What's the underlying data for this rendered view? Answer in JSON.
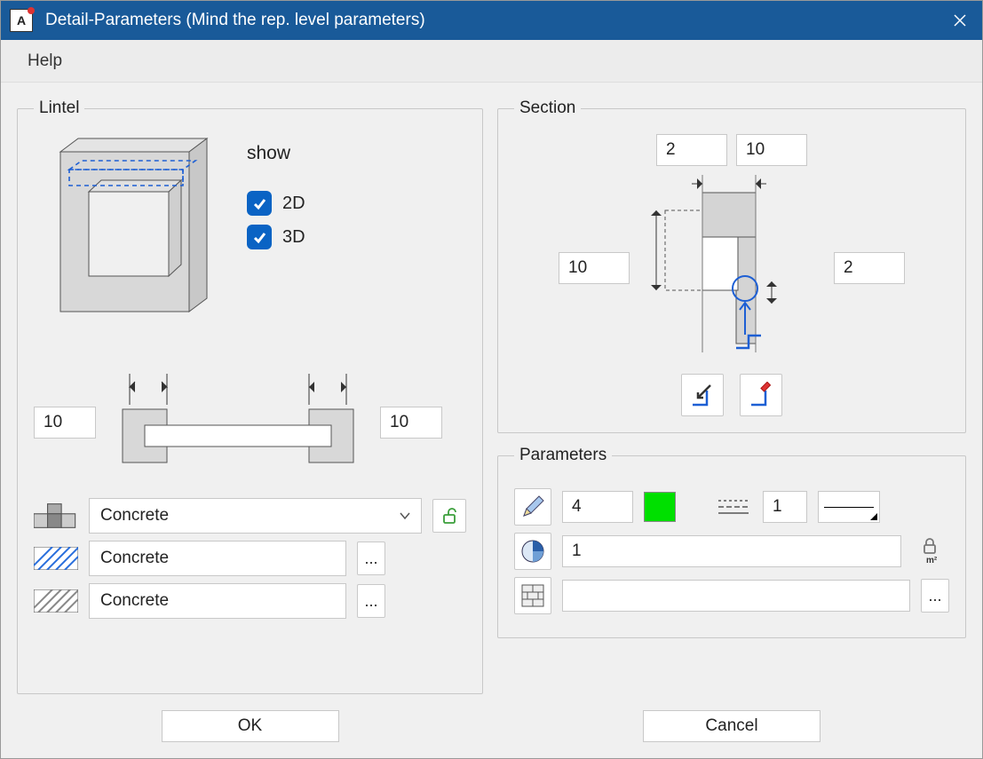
{
  "window": {
    "title": "Detail-Parameters (Mind the rep. level parameters)"
  },
  "menu": {
    "help": "Help"
  },
  "lintel": {
    "legend": "Lintel",
    "show_label": "show",
    "chk_2d": "2D",
    "chk_3d": "3D",
    "lap_left": "10",
    "lap_right": "10",
    "material_combo": "Concrete",
    "hatch1": "Concrete",
    "hatch2": "Concrete",
    "more_btn": "..."
  },
  "section": {
    "legend": "Section",
    "top_left": "2",
    "top_right": "10",
    "side_left": "10",
    "side_right": "2"
  },
  "parameters": {
    "legend": "Parameters",
    "pen_value": "4",
    "line_value": "1",
    "layer_value": "1",
    "surface_value": "",
    "more_btn": "..."
  },
  "buttons": {
    "ok": "OK",
    "cancel": "Cancel"
  },
  "colors": {
    "pen_color": "#00e000",
    "accent": "#0a63c4"
  }
}
